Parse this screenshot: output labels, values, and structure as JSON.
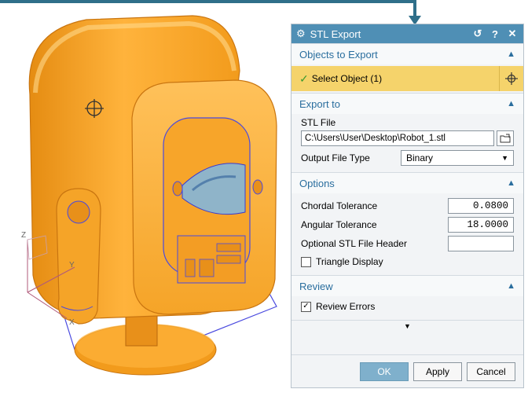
{
  "dialog": {
    "title": "STL Export",
    "title_icon": "gear-icon",
    "header_icons": [
      "reset-icon",
      "help-icon",
      "close-icon"
    ],
    "header_symbols": [
      "↺",
      "?",
      "✕"
    ]
  },
  "objects_section": {
    "label": "Objects to Export",
    "select_label": "Select Object (1)"
  },
  "export_section": {
    "label": "Export to",
    "stl_file_label": "STL File",
    "stl_file_value": "C:\\Users\\User\\Desktop\\Robot_1.stl",
    "output_type_label": "Output File Type",
    "output_type_value": "Binary"
  },
  "options_section": {
    "label": "Options",
    "chordal_label": "Chordal Tolerance",
    "chordal_value": "0.0800",
    "angular_label": "Angular Tolerance",
    "angular_value": "18.0000",
    "header_label": "Optional STL File Header",
    "header_value": "",
    "triangle_label": "Triangle Display",
    "triangle_checked": false
  },
  "review_section": {
    "label": "Review",
    "review_errors_label": "Review Errors",
    "review_errors_checked": true
  },
  "buttons": {
    "ok": "OK",
    "apply": "Apply",
    "cancel": "Cancel"
  },
  "viewport": {
    "axis_labels": [
      "Z",
      "Y",
      "X"
    ],
    "model_color": "#f5a623",
    "edge_color": "#4a4adf"
  },
  "colors": {
    "titlebar": "#4f8fb5",
    "section_text": "#2a6e9e",
    "selection_highlight": "#f5d36b",
    "callout": "#2f6f8a"
  }
}
